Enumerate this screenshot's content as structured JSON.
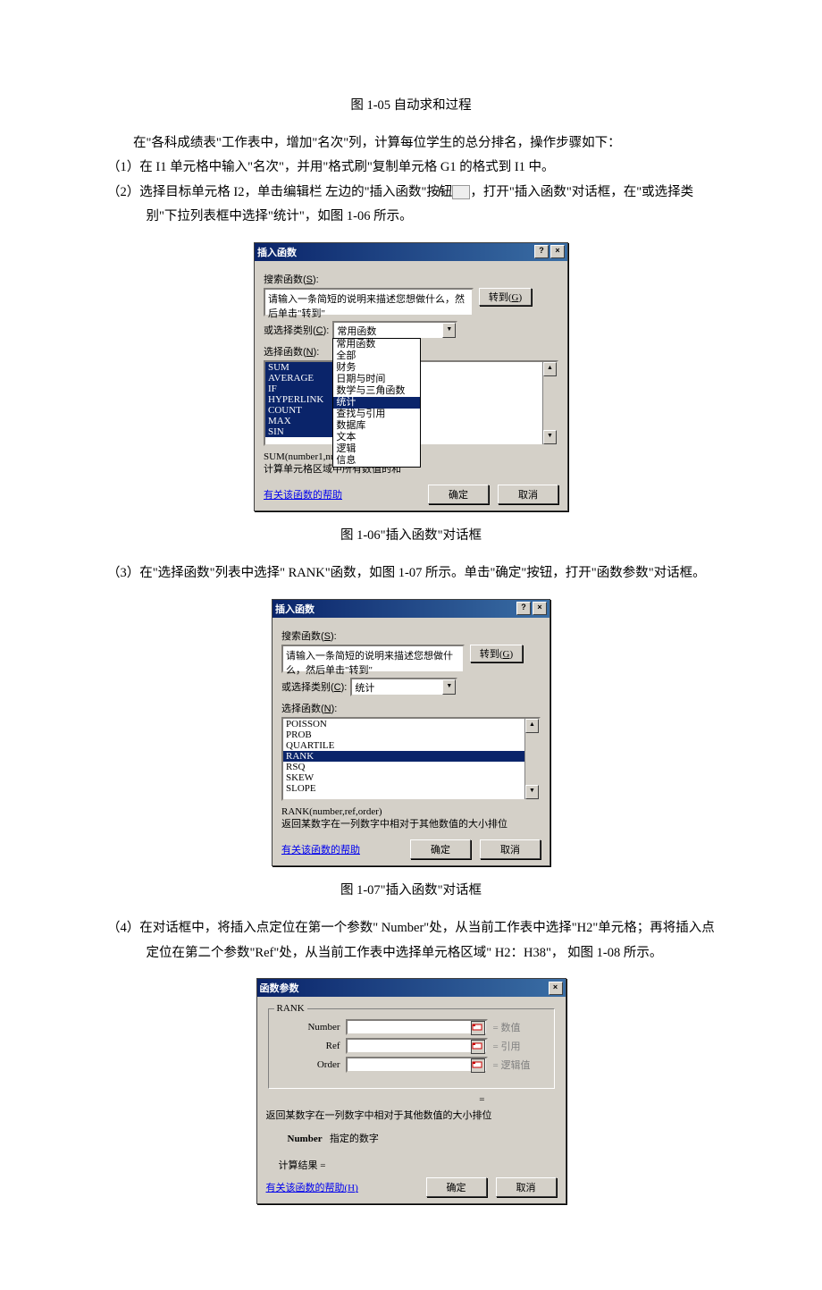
{
  "body": {
    "caption1": "图 1-05 自动求和过程",
    "intro": "在\"各科成绩表\"工作表中，增加\"名次\"列，计算每位学生的总分排名，操作步骤如下：",
    "step1": "（1）在 I1 单元格中输入\"名次\"，并用\"格式刷\"复制单元格 G1 的格式到 I1 中。",
    "step2_a": "（2）选择目标单元格 I2，单击编辑栏 左边的\"插入函数\"按钮",
    "step2_b": "，打开\"插入函数\"对话框，在\"或选择类别\"下拉列表框中选择\"统计\"，如图 1-06 所示。",
    "caption2": "图 1-06\"插入函数\"对话框",
    "step3": "（3）在\"选择函数\"列表中选择\" RANK\"函数，如图 1-07 所示。单击\"确定\"按钮，打开\"函数参数\"对话框。",
    "caption3": "图 1-07\"插入函数\"对话框",
    "step4": "（4）在对话框中，将插入点定位在第一个参数\" Number\"处，从当前工作表中选择\"H2\"单元格；再将插入点定位在第二个参数\"Ref\"处，从当前工作表中选择单元格区域\" H2：H38\"，  如图 1-08 所示。"
  },
  "dlg1": {
    "title": "插入函数",
    "search_lbl_a": "搜索函数(",
    "search_lbl_u": "S",
    "search_lbl_b": "):",
    "search_txt": "请输入一条简短的说明来描述您想做什么，然后单击\"转到\"",
    "go_a": "转到(",
    "go_u": "G",
    "go_b": ")",
    "cat_lbl_a": "或选择类别(",
    "cat_lbl_u": "C",
    "cat_lbl_b": "):",
    "cat_val": "常用函数",
    "dropdown": [
      "常用函数",
      "全部",
      "财务",
      "日期与时间",
      "数学与三角函数",
      "统计",
      "查找与引用",
      "数据库",
      "文本",
      "逻辑",
      "信息"
    ],
    "dd_sel_index": 5,
    "sel_lbl_a": "选择函数(",
    "sel_lbl_u": "N",
    "sel_lbl_b": "):",
    "funcs": [
      "SUM",
      "AVERAGE",
      "IF",
      "HYPERLINK",
      "COUNT",
      "MAX",
      "SIN"
    ],
    "desc1": "SUM(number1,num",
    "desc2": "计算单元格区域中所有数值的和",
    "help": "有关该函数的帮助",
    "ok": "确定",
    "cancel": "取消"
  },
  "dlg2": {
    "title": "插入函数",
    "cat_val": "统计",
    "funcs": [
      "POISSON",
      "PROB",
      "QUARTILE",
      "RANK",
      "RSQ",
      "SKEW",
      "SLOPE"
    ],
    "sel_index": 3,
    "desc1": "RANK(number,ref,order)",
    "desc2": "返回某数字在一列数字中相对于其他数值的大小排位",
    "help": "有关该函数的帮助",
    "ok": "确定",
    "cancel": "取消"
  },
  "dlg3": {
    "title": "函数参数",
    "group": "RANK",
    "params": [
      {
        "name": "Number",
        "hint": "= 数值"
      },
      {
        "name": "Ref",
        "hint": "= 引用"
      },
      {
        "name": "Order",
        "hint": "= 逻辑值"
      }
    ],
    "eq": "=",
    "desc": "返回某数字在一列数字中相对于其他数值的大小排位",
    "argname": "Number",
    "argdesc": "指定的数字",
    "result_lbl": "计算结果 =",
    "help_a": "有关该函数的帮助(",
    "help_u": "H",
    "help_b": ")",
    "ok": "确定",
    "cancel": "取消"
  }
}
